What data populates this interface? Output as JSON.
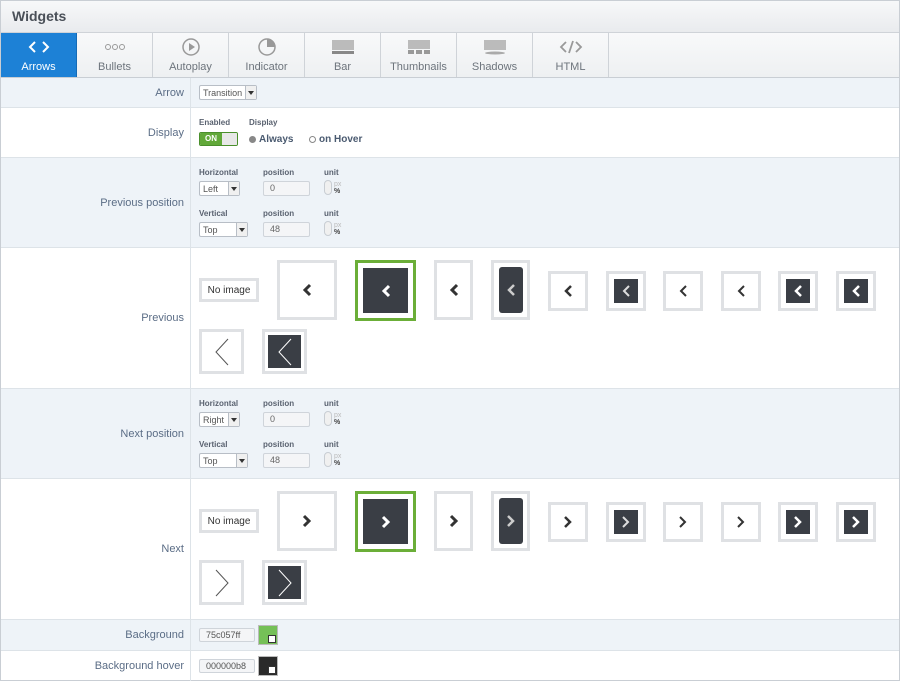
{
  "window": {
    "title": "Widgets"
  },
  "tabs": [
    {
      "label": "Arrows",
      "icon": "code-arrows-icon"
    },
    {
      "label": "Bullets",
      "icon": "bullets-icon"
    },
    {
      "label": "Autoplay",
      "icon": "play-icon"
    },
    {
      "label": "Indicator",
      "icon": "pie-indicator-icon"
    },
    {
      "label": "Bar",
      "icon": "bar-icon"
    },
    {
      "label": "Thumbnails",
      "icon": "thumbnails-icon"
    },
    {
      "label": "Shadows",
      "icon": "shadows-icon"
    },
    {
      "label": "HTML",
      "icon": "html-code-icon"
    }
  ],
  "arrow": {
    "label": "Arrow",
    "select": "Transition"
  },
  "display": {
    "label": "Display",
    "enabled_label": "Enabled",
    "display_label": "Display",
    "toggle": "ON",
    "opt_always": "Always",
    "opt_hover": "on Hover"
  },
  "prev_position": {
    "label": "Previous position",
    "h_label": "Horizontal",
    "h_value": "Left",
    "pos_label": "position",
    "h_pos": "0",
    "unit_label": "unit",
    "unit_px": "px",
    "unit_pct": "%",
    "v_label": "Vertical",
    "v_value": "Top",
    "v_pos": "48"
  },
  "previous": {
    "label": "Previous",
    "no_image": "No image"
  },
  "next_position": {
    "label": "Next position",
    "h_label": "Horizontal",
    "h_value": "Right",
    "pos_label": "position",
    "h_pos": "0",
    "unit_label": "unit",
    "unit_px": "px",
    "unit_pct": "%",
    "v_label": "Vertical",
    "v_value": "Top",
    "v_pos": "48"
  },
  "next": {
    "label": "Next",
    "no_image": "No image"
  },
  "background": {
    "label": "Background",
    "value": "75c057ff",
    "color": "#75c057"
  },
  "background_hover": {
    "label": "Background hover",
    "value": "000000b8",
    "color": "#2a2a2a"
  },
  "colors": {
    "accent": "#1d81d6",
    "selected": "#6bae38"
  }
}
